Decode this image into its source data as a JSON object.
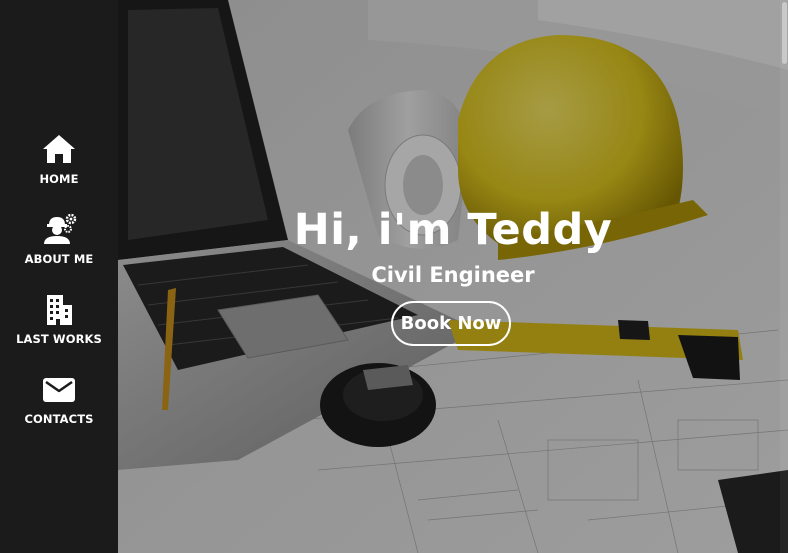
{
  "nav": {
    "items": [
      {
        "label": "HOME",
        "icon": "home-icon"
      },
      {
        "label": "ABOUT ME",
        "icon": "engineer-icon"
      },
      {
        "label": "LAST WORKS",
        "icon": "building-icon"
      },
      {
        "label": "CONTACTS",
        "icon": "mail-icon"
      }
    ]
  },
  "hero": {
    "title": "Hi, i'm Teddy",
    "subtitle": "Civil Engineer",
    "button_label": "Book Now",
    "background": "construction-desk-photo"
  },
  "colors": {
    "sidebar": "#1b1b1c",
    "text": "#ffffff",
    "helmet": "#e8cf1f"
  }
}
